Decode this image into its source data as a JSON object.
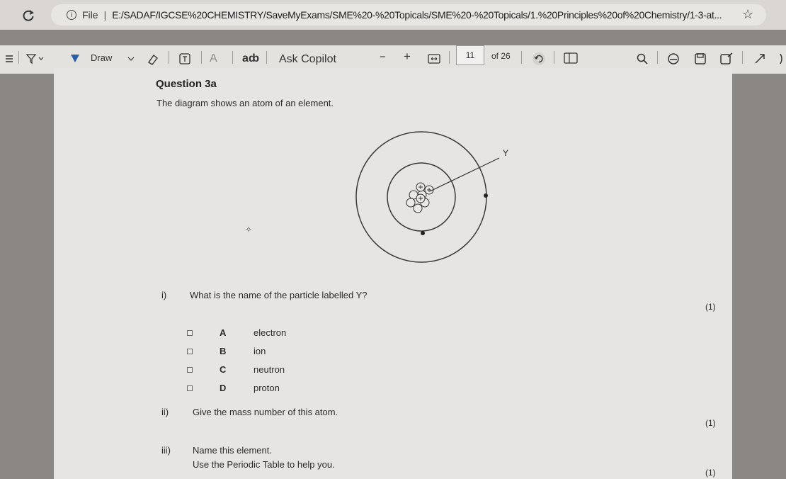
{
  "browser": {
    "scheme": "File",
    "url": "E:/SADAF/IGCSE%20CHEMISTRY/SaveMyExams/SME%20-%20Topicals/SME%20-%20Topicals/1.%20Principles%20of%20Chemistry/1-3-at..."
  },
  "toolbar": {
    "draw_label": "Draw",
    "text_icon_label": "A",
    "ab_label": "aȸ",
    "copilot_label": "Ask Copilot",
    "minus_label": "−",
    "plus_label": "+",
    "page_current": "11",
    "page_total": "of 26"
  },
  "question": {
    "title": "Question 3a",
    "intro": "The diagram shows an atom of an element.",
    "diagram_label": "Y",
    "part_i": {
      "number": "i)",
      "text": "What is the name of the particle labelled Y?",
      "marks": "(1)",
      "options": [
        {
          "letter": "A",
          "text": "electron"
        },
        {
          "letter": "B",
          "text": "ion"
        },
        {
          "letter": "C",
          "text": "neutron"
        },
        {
          "letter": "D",
          "text": "proton"
        }
      ]
    },
    "part_ii": {
      "number": "ii)",
      "text": "Give the mass number of this atom.",
      "marks": "(1)"
    },
    "part_iii": {
      "number": "iii)",
      "text": "Name this element.",
      "text2": "Use the Periodic Table to help you.",
      "marks": "(1)"
    }
  }
}
